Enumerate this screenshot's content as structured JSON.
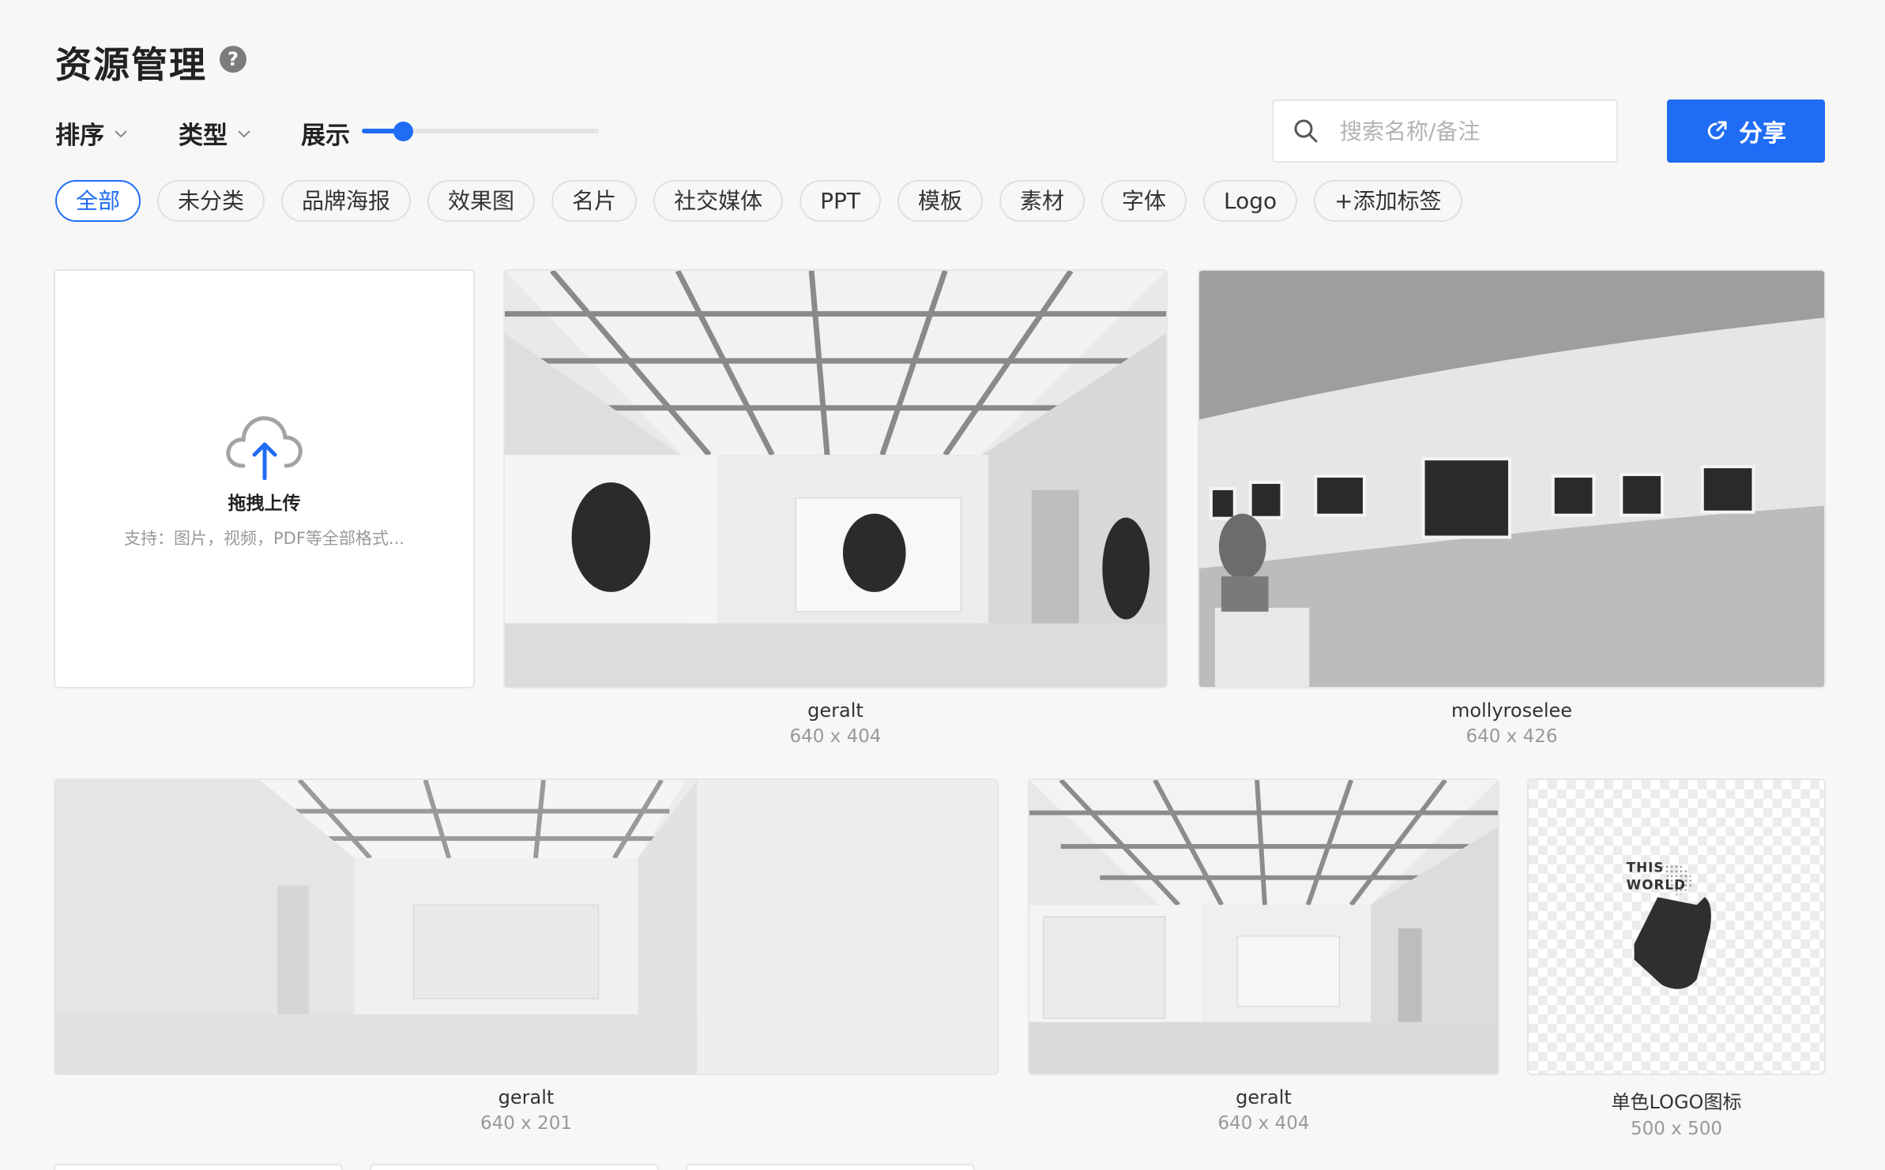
{
  "header": {
    "title": "资源管理",
    "help_icon": "help-icon"
  },
  "toolbar": {
    "sort_label": "排序",
    "type_label": "类型",
    "display_label": "展示",
    "display_size": 0.1,
    "search_placeholder": "搜索名称/备注",
    "share_label": "分享"
  },
  "tags": [
    "全部",
    "未分类",
    "品牌海报",
    "效果图",
    "名片",
    "社交媒体",
    "PPT",
    "模板",
    "素材",
    "字体",
    "Logo",
    "+添加标签"
  ],
  "active_tag": "全部",
  "upload": {
    "title": "拖拽上传",
    "subtitle": "支持：图片，视频，PDF等全部格式..."
  },
  "assets": [
    {
      "name": "geralt",
      "size": "640 x 404"
    },
    {
      "name": "mollyroselee",
      "size": "640 x 426"
    },
    {
      "name": "geralt",
      "size": "640 x 201"
    },
    {
      "name": "geralt",
      "size": "640 x 404"
    },
    {
      "name": "单色LOGO图标",
      "size": "500 x 500",
      "logo_text": [
        "THIS",
        "WORLD"
      ]
    }
  ],
  "colors": {
    "accent": "#1f6cf5",
    "background": "#f7f7f6"
  }
}
